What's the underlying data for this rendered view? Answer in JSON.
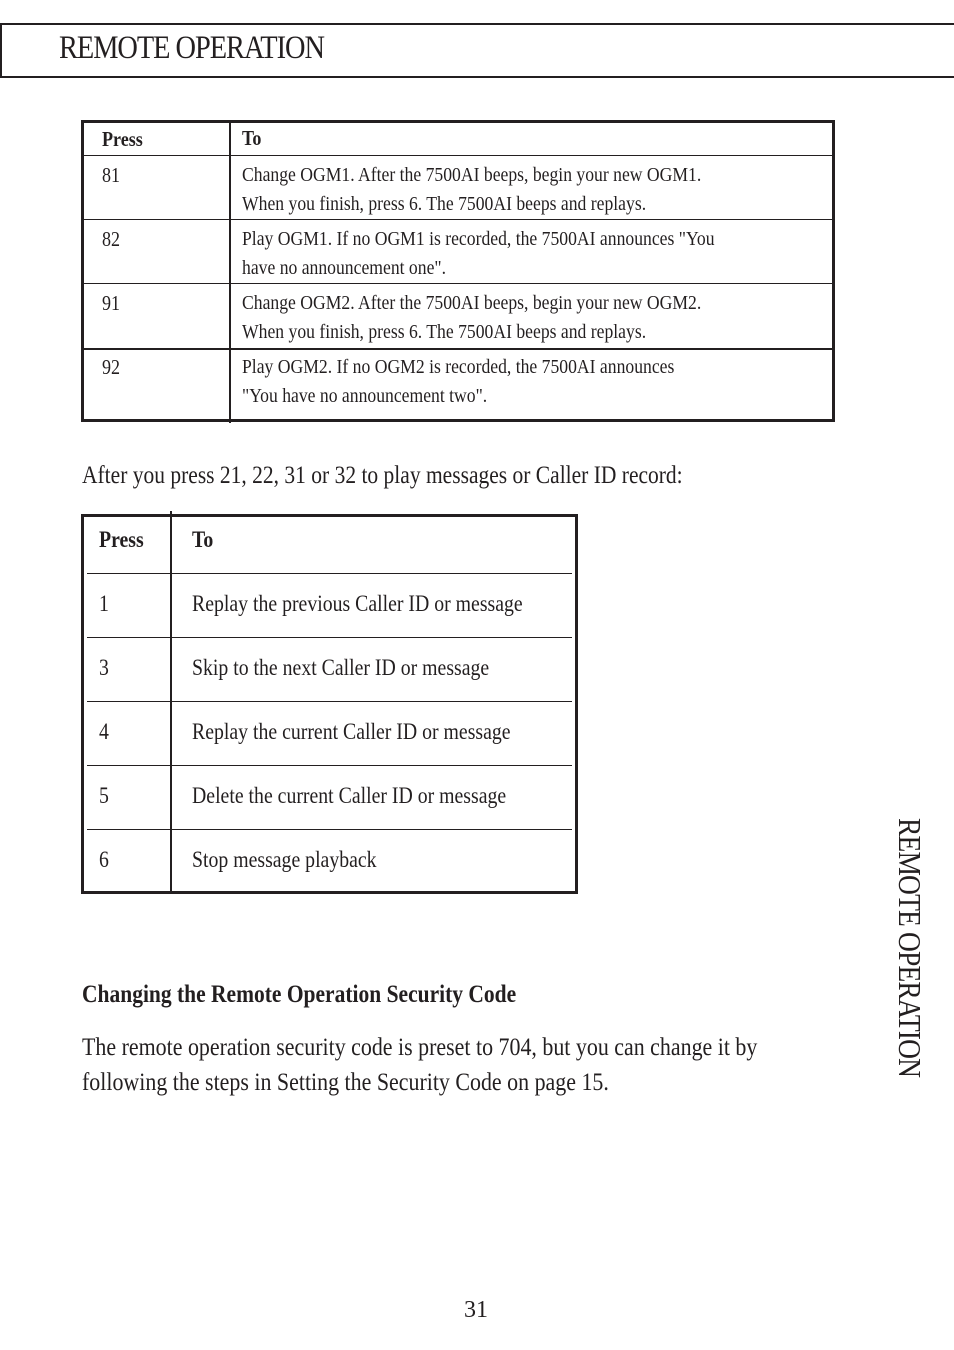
{
  "header": {
    "title": "REMOTE OPERATION"
  },
  "ogm_table": {
    "columns": [
      "Press",
      "To"
    ],
    "rows": [
      {
        "press": "81",
        "lines": [
          "Change OGM1.  After the 7500AI beeps, begin your new OGM1.",
          "When you finish, press 6.  The 7500AI beeps and replays."
        ]
      },
      {
        "press": "82",
        "lines": [
          "Play OGM1.  If no OGM1 is recorded, the 7500AI announces \"You",
          "have  no announcement one\"."
        ]
      },
      {
        "press": "91",
        "lines": [
          "Change OGM2.  After the 7500AI beeps, begin your new OGM2.",
          "When you finish, press 6.  The 7500AI beeps and replays."
        ]
      },
      {
        "press": "92",
        "lines": [
          "Play OGM2.  If no OGM2 is recorded, the 7500AI announces",
          "\"You have no announcement two\"."
        ]
      }
    ]
  },
  "intro_text": "After you press 21, 22, 31 or 32 to play messages or Caller ID record:",
  "playback_table": {
    "columns": [
      "Press",
      "To"
    ],
    "rows": [
      {
        "press": "1",
        "to": "Replay the previous Caller ID or message"
      },
      {
        "press": "3",
        "to": "Skip to the next Caller ID or message"
      },
      {
        "press": "4",
        "to": "Replay the current Caller ID or message"
      },
      {
        "press": "5",
        "to": "Delete the current Caller ID or message"
      },
      {
        "press": "6",
        "to": "Stop message playback"
      }
    ]
  },
  "security_section": {
    "heading": "Changing the Remote Operation Security Code",
    "body_lines": [
      "The remote operation security code is preset to 704, but you can change it by",
      "following the steps in Setting the Security Code on page 15."
    ]
  },
  "side_tab": "REMOTE OPERATION",
  "page_number": "31"
}
